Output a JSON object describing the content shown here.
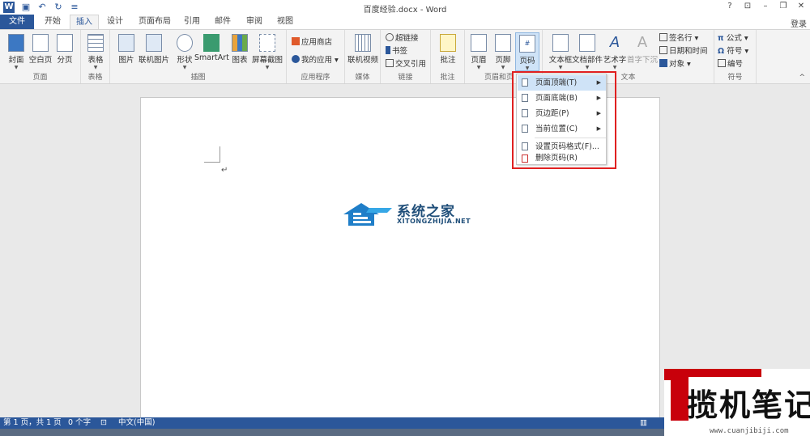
{
  "titlebar": {
    "title": "百度经验.docx - Word",
    "app_glyph": "W",
    "buttons": [
      "?",
      "⊡",
      "–",
      "❐",
      "✕"
    ]
  },
  "tabs": [
    {
      "label": "文件"
    },
    {
      "label": "开始"
    },
    {
      "label": "插入"
    },
    {
      "label": "设计"
    },
    {
      "label": "页面布局"
    },
    {
      "label": "引用"
    },
    {
      "label": "邮件"
    },
    {
      "label": "审阅"
    },
    {
      "label": "视图"
    }
  ],
  "login": "登录",
  "ribbon": {
    "pages": {
      "label": "页面",
      "cover": "封面",
      "blank": "空白页",
      "break": "分页"
    },
    "tables": {
      "label": "表格",
      "table": "表格"
    },
    "illustrations": {
      "label": "插图",
      "picture": "图片",
      "online_picture": "联机图片",
      "shapes": "形状",
      "smartart": "SmartArt",
      "chart": "图表",
      "screenshot": "屏幕截图"
    },
    "apps": {
      "label": "应用程序",
      "store": "应用商店",
      "my_apps": "我的应用"
    },
    "media": {
      "label": "媒体",
      "online_video": "联机视频"
    },
    "links": {
      "label": "链接",
      "hyperlink": "超链接",
      "bookmark": "书签",
      "cross_ref": "交叉引用"
    },
    "comments": {
      "label": "批注",
      "comment": "批注"
    },
    "header_footer": {
      "label": "页眉和页",
      "header": "页眉",
      "footer": "页脚",
      "page_number": "页码"
    },
    "text": {
      "label": "文本",
      "textbox": "文本框",
      "quickparts": "文档部件",
      "wordart": "艺术字",
      "dropcap": "首字下沉",
      "signature": "签名行",
      "datetime": "日期和时间",
      "object": "对象"
    },
    "symbols": {
      "label": "符号",
      "equation": "公式",
      "symbol": "符号",
      "number": "编号"
    }
  },
  "dropdown": {
    "items": [
      {
        "label": "页面顶端(T)",
        "submenu": true
      },
      {
        "label": "页面底端(B)",
        "submenu": true
      },
      {
        "label": "页边距(P)",
        "submenu": true
      },
      {
        "label": "当前位置(C)",
        "submenu": true
      },
      {
        "label": "设置页码格式(F)...",
        "submenu": false
      },
      {
        "label": "删除页码(R)",
        "submenu": false
      }
    ]
  },
  "watermark": {
    "cn": "系统之家",
    "en": "XITONGZHIJIA.NET"
  },
  "statusbar": {
    "page": "第 1 页，共 1 页",
    "words": "0 个字",
    "lang": "中文(中国)"
  },
  "brand": {
    "name": "揽机笔记",
    "url": "www.cuanjibiji.com"
  },
  "colors": {
    "accent": "#2b579a",
    "highlight": "#cfe3f7",
    "red_box": "#e02020",
    "brand_red": "#c8000b"
  }
}
